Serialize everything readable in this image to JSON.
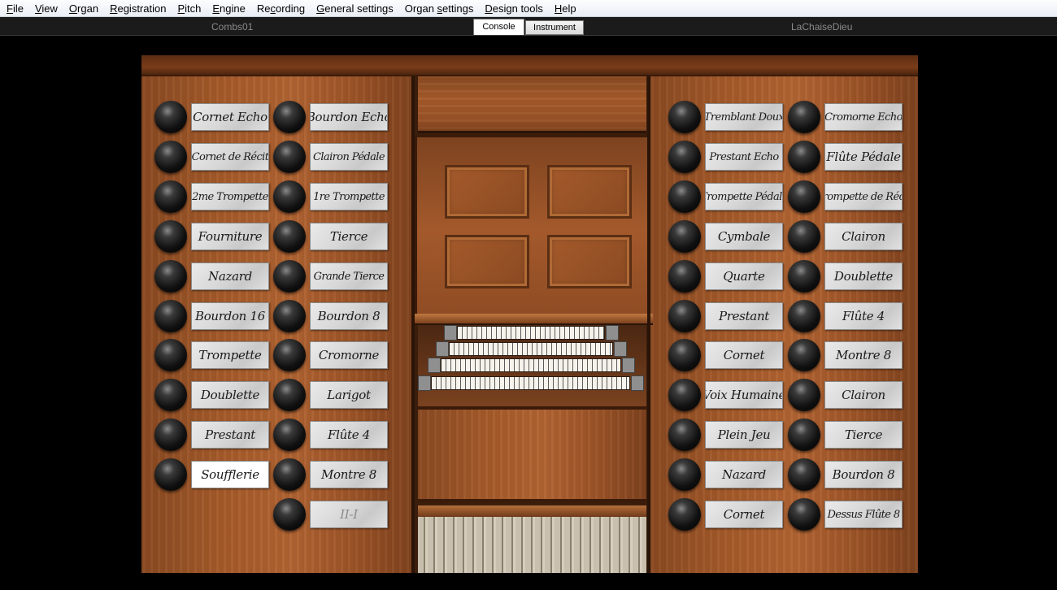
{
  "menu": [
    {
      "u": "F",
      "rest": "ile"
    },
    {
      "u": "V",
      "rest": "iew"
    },
    {
      "u": "O",
      "rest": "rgan"
    },
    {
      "u": "R",
      "rest": "egistration"
    },
    {
      "u": "P",
      "rest": "itch"
    },
    {
      "u": "E",
      "rest": "ngine"
    },
    {
      "pre": "Re",
      "u": "c",
      "rest": "ording"
    },
    {
      "u": "G",
      "rest": "eneral settings"
    },
    {
      "pre": "Organ ",
      "u": "s",
      "rest": "ettings"
    },
    {
      "u": "D",
      "rest": "esign tools"
    },
    {
      "u": "H",
      "rest": "elp"
    }
  ],
  "toolbar": {
    "left_label": "Combs01",
    "right_label": "LaChaiseDieu",
    "tab_console": "Console",
    "tab_instrument": "Instrument",
    "active_tab": "Console"
  },
  "stops": {
    "left_col1": [
      "Cornet Echo",
      "Cornet de Récit",
      "2me Trompette",
      "Fourniture",
      "Nazard",
      "Bourdon 16",
      "Trompette",
      "Doublette",
      "Prestant",
      "Soufflerie"
    ],
    "left_col2": [
      "Bourdon Echo",
      "Clairon Pédale",
      "1re Trompette",
      "Tierce",
      "Grande Tierce",
      "Bourdon 8",
      "Cromorne",
      "Larigot",
      "Flûte 4",
      "Montre 8",
      "II-I"
    ],
    "right_col1": [
      "Tremblant Doux",
      "Prestant Echo",
      "Trompette Pédale",
      "Cymbale",
      "Quarte",
      "Prestant",
      "Cornet",
      "Voix Humaine",
      "Plein Jeu",
      "Nazard",
      "Cornet"
    ],
    "right_col2": [
      "Cromorne Echo",
      "Flûte Pédale",
      "Trompette de Récit",
      "Clairon",
      "Doublette",
      "Flûte 4",
      "Montre 8",
      "Clairon",
      "Tierce",
      "Bourdon 8",
      "Dessus Flûte 8"
    ],
    "active": [
      "Soufflerie"
    ],
    "faded": [
      "II-I"
    ]
  }
}
